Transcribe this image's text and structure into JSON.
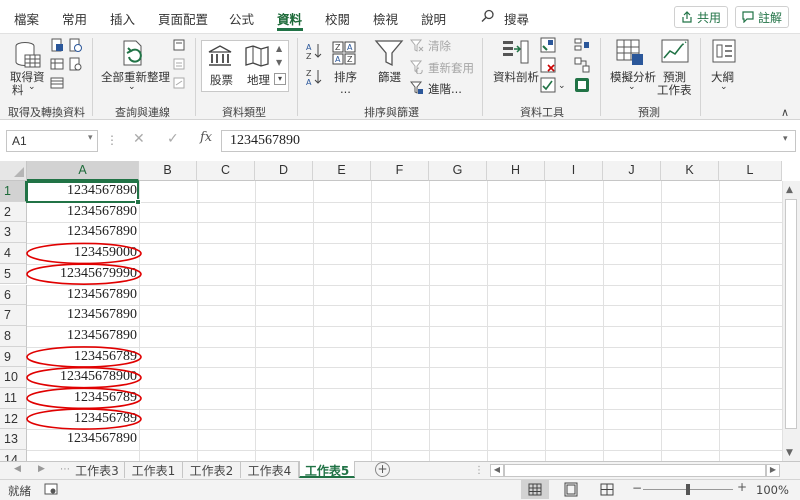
{
  "ribbon_tabs": [
    "檔案",
    "常用",
    "插入",
    "頁面配置",
    "公式",
    "資料",
    "校閱",
    "檢視",
    "說明"
  ],
  "active_tab": "資料",
  "search_label": "搜尋",
  "share_label": "共用",
  "comment_label": "註解",
  "ribbon": {
    "get_data": "取得資",
    "get_data_2": "料",
    "refresh_all": "全部重新整理",
    "stocks": "股票",
    "geography": "地理",
    "sort": "排序",
    "sort_more": "...",
    "filter": "篩選",
    "clear": "清除",
    "reapply": "重新套用",
    "advanced": "進階...",
    "text_to_columns": "資料剖析",
    "what_if": "模擬分析",
    "forecast_1": "預測",
    "forecast_2": "工作表",
    "outline": "大綱",
    "groups": [
      "取得及轉換資料",
      "查詢與連線",
      "資料類型",
      "排序與篩選",
      "資料工具",
      "預測"
    ]
  },
  "name_box": "A1",
  "formula": "1234567890",
  "columns": [
    "A",
    "B",
    "C",
    "D",
    "E",
    "F",
    "G",
    "H",
    "I",
    "J",
    "K",
    "L"
  ],
  "rows": [
    "1",
    "2",
    "3",
    "4",
    "5",
    "6",
    "7",
    "8",
    "9",
    "10",
    "11",
    "12",
    "13",
    "14"
  ],
  "cells_a": [
    "1234567890",
    "1234567890",
    "1234567890",
    "123459000",
    "12345679990",
    "1234567890",
    "1234567890",
    "1234567890",
    "123456789",
    "12345678900",
    "123456789",
    "123456789",
    "1234567890",
    ""
  ],
  "highlight_rows": [
    4,
    5,
    9,
    10,
    11,
    12
  ],
  "highlight_color": "#e00000",
  "accent_color": "#217346",
  "sheet_tabs": [
    "工作表3",
    "工作表1",
    "工作表2",
    "工作表4",
    "工作表5"
  ],
  "active_sheet": "工作表5",
  "status": "就緒",
  "zoom": "100%"
}
